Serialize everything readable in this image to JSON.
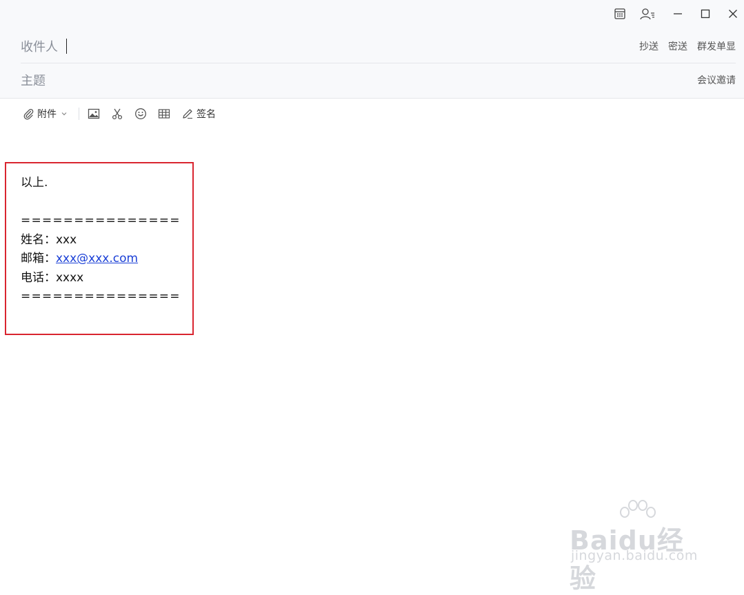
{
  "window_controls": {
    "icons": [
      "calendar-icon",
      "contacts-icon",
      "minimize-icon",
      "maximize-icon",
      "close-icon"
    ]
  },
  "compose": {
    "to_label": "收件人",
    "cc_label": "抄送",
    "bcc_label": "密送",
    "separate_send_label": "群发单显",
    "subject_label": "主题",
    "meeting_invite_label": "会议邀请"
  },
  "toolbar": {
    "attachment_label": "附件",
    "signature_label": "签名",
    "icons": [
      "paperclip-icon",
      "chevron-down-icon",
      "image-icon",
      "scissors-icon",
      "emoji-icon",
      "table-icon",
      "pen-icon"
    ]
  },
  "body": {
    "line1": "以上.",
    "separator": "===============",
    "name_label": "姓名：",
    "name_value": "xxx",
    "email_label": "邮箱：",
    "email_value": "xxx@xxx.com",
    "phone_label": "电话：",
    "phone_value": "xxxx"
  },
  "watermark": {
    "brand": "Baidu经验",
    "url": "jingyan.baidu.com"
  },
  "colors": {
    "header_bg": "#f8f9fb",
    "highlight_border": "#d9242f",
    "link": "#1a3fd6"
  }
}
